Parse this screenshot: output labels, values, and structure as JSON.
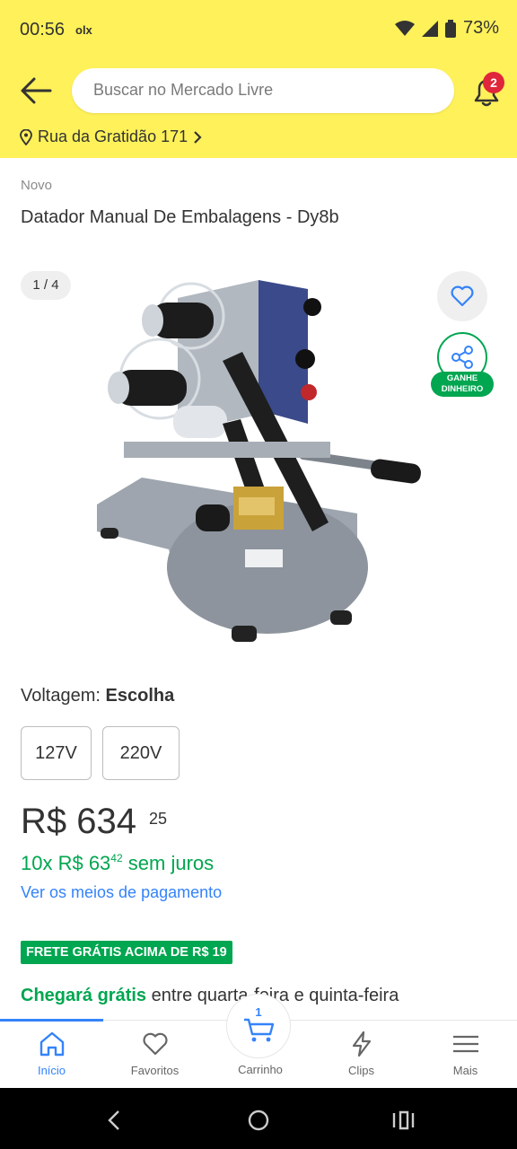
{
  "status_bar": {
    "time": "00:56",
    "app_tag": "olx",
    "battery": "73%"
  },
  "header": {
    "search_placeholder": "Buscar no Mercado Livre",
    "notifications_count": "2",
    "address": "Rua da Gratidão 171"
  },
  "product": {
    "condition": "Novo",
    "title": "Datador Manual De Embalagens - Dy8b",
    "image_counter": "1 / 4",
    "share_label": "GANHE DINHEIRO",
    "voltage_label": "Voltagem:",
    "voltage_value": "Escolha",
    "voltage_options": [
      "127V",
      "220V"
    ],
    "price_main": "R$ 634",
    "price_cents": "25",
    "installments_prefix": "10x R$ 63",
    "installments_cents": "42",
    "installments_suffix": " sem juros",
    "payment_link": "Ver os meios de pagamento",
    "shipping_badge": "FRETE GRÁTIS ACIMA DE R$ 19",
    "arrival_strong": "Chegará grátis",
    "arrival_rest": " entre quarta-feira e quinta-feira"
  },
  "bottom_nav": {
    "items": [
      {
        "label": "Início",
        "icon": "home-icon",
        "active": true
      },
      {
        "label": "Favoritos",
        "icon": "heart-icon"
      },
      {
        "label": "Carrinho",
        "icon": "cart-icon",
        "count": "1"
      },
      {
        "label": "Clips",
        "icon": "lightning-icon"
      },
      {
        "label": "Mais",
        "icon": "menu-icon"
      }
    ]
  },
  "colors": {
    "brand_yellow": "#fff159",
    "accent_blue": "#3483fa",
    "success_green": "#00a650",
    "badge_red": "#e0263a"
  }
}
